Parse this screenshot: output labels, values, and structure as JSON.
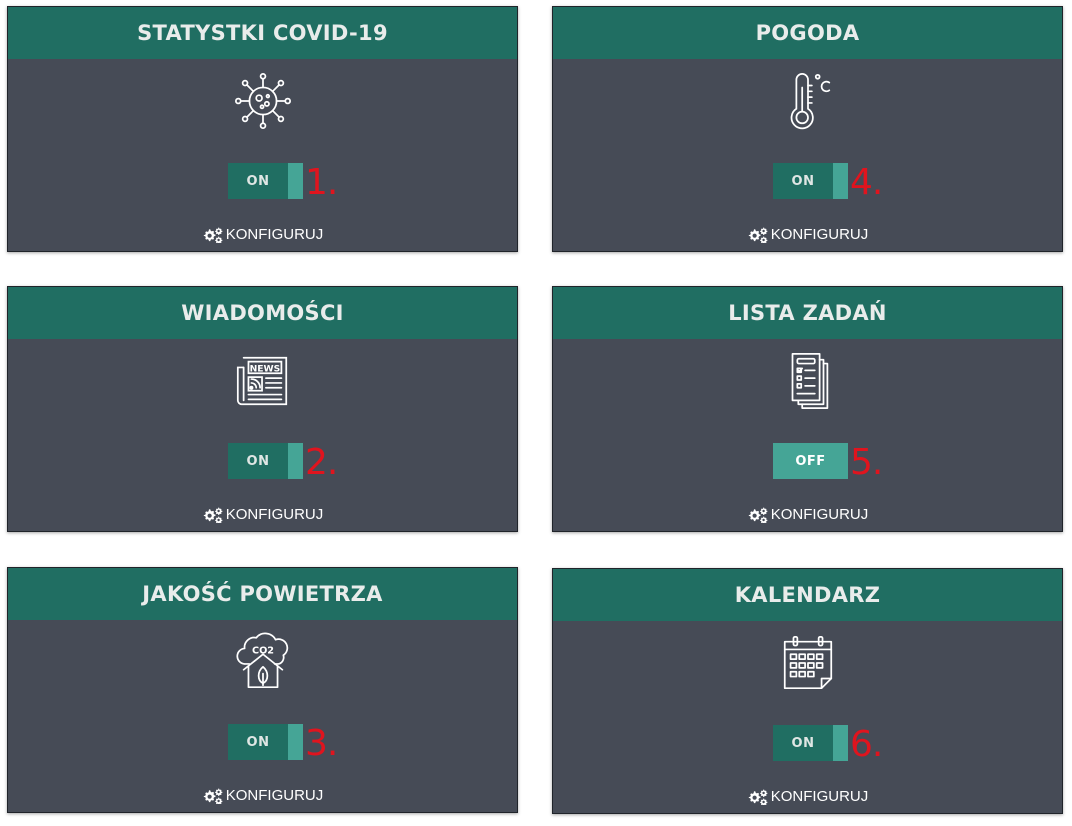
{
  "cards": [
    {
      "title": "STATYSTKI COVID-19",
      "icon": "virus-icon",
      "toggle": "ON",
      "state": "on",
      "badge": "1.",
      "config_label": "KONFIGURUJ"
    },
    {
      "title": "POGODA",
      "icon": "thermometer-icon",
      "toggle": "ON",
      "state": "on",
      "badge": "4.",
      "config_label": "KONFIGURUJ"
    },
    {
      "title": "WIADOMOŚCI",
      "icon": "newspaper-icon",
      "toggle": "ON",
      "state": "on",
      "badge": "2.",
      "config_label": "KONFIGURUJ"
    },
    {
      "title": "LISTA ZADAŃ",
      "icon": "checklist-icon",
      "toggle": "OFF",
      "state": "off",
      "badge": "5.",
      "config_label": "KONFIGURUJ"
    },
    {
      "title": "JAKOŚĆ POWIETRZA",
      "icon": "co2-cloud-house-icon",
      "toggle": "ON",
      "state": "on",
      "badge": "3.",
      "config_label": "KONFIGURUJ"
    },
    {
      "title": "KALENDARZ",
      "icon": "calendar-icon",
      "toggle": "ON",
      "state": "on",
      "badge": "6.",
      "config_label": "KONFIGURUJ"
    }
  ],
  "colors": {
    "header": "#206e62",
    "card_body": "#464b56",
    "toggle_knob": "#45a596",
    "badge": "#e0141e"
  }
}
